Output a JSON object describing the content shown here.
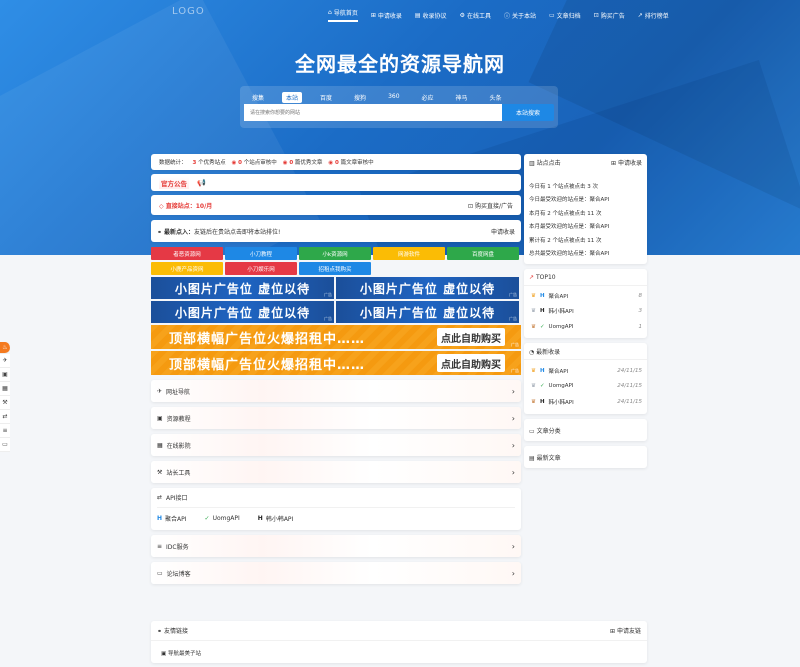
{
  "header": {
    "logo": "LOGO",
    "nav": [
      {
        "label": "导航首页",
        "icon": "home-icon",
        "glyph": "⌂"
      },
      {
        "label": "申请收录",
        "icon": "plus-square-icon",
        "glyph": "⊞"
      },
      {
        "label": "收录协议",
        "icon": "file-icon",
        "glyph": "▤"
      },
      {
        "label": "在线工具",
        "icon": "tools-icon",
        "glyph": "⚙"
      },
      {
        "label": "关于本站",
        "icon": "info-icon",
        "glyph": "ⓘ"
      },
      {
        "label": "文章归档",
        "icon": "folder-icon",
        "glyph": "▭"
      },
      {
        "label": "购买广告",
        "icon": "cart-icon",
        "glyph": "⊡"
      },
      {
        "label": "排行榜单",
        "icon": "chart-icon",
        "glyph": "↗"
      }
    ],
    "title": "全网最全的资源导航网"
  },
  "search": {
    "tabs": [
      "搜集",
      "本站",
      "百度",
      "搜狗",
      "360",
      "必应",
      "神马",
      "头条"
    ],
    "active_tab": 1,
    "placeholder": "请在搜索你想要的网站",
    "button": "本站搜索"
  },
  "stats": {
    "label": "数据统计：",
    "sites_num": "3",
    "sites_text": "个优秀站点",
    "review_num": "0",
    "review_text": "个站点审核中",
    "articles_num": "0",
    "articles_text": "篇优秀文章",
    "articles_review_num": "0",
    "articles_review_text": "篇文章审核中"
  },
  "notice": {
    "label": "官方公告",
    "icon": "megaphone-icon"
  },
  "direct": {
    "label": "直接站点：10/月",
    "buy": "购买直接/广告"
  },
  "latest": {
    "label": "最新点入：",
    "text": "友链后在贵站点击即将本站排位!",
    "apply": "申请收录"
  },
  "color_buttons": [
    {
      "label": "者恶资源网",
      "color": "#e53945"
    },
    {
      "label": "小刀教程",
      "color": "#1e88e5"
    },
    {
      "label": "小k资源网",
      "color": "#2ea84a"
    },
    {
      "label": "网游软件",
      "color": "#fbbc05"
    },
    {
      "label": "百度网盘",
      "color": "#2ea84a"
    },
    {
      "label": "小鹿产品资网",
      "color": "#fbbc05"
    },
    {
      "label": "小刀娱乐网",
      "color": "#e53945"
    },
    {
      "label": "招租点我购买",
      "color": "#1e88e5"
    }
  ],
  "ads_small": [
    "小图片广告位 虚位以待",
    "小图片广告位 虚位以待",
    "小图片广告位 虚位以待",
    "小图片广告位 虚位以待"
  ],
  "ad_tag": "广告",
  "ads_wide": {
    "text": "顶部横幅广告位火爆招租中……",
    "button": "点此自助购买"
  },
  "sections": [
    {
      "label": "网址导航",
      "icon": "send-icon",
      "glyph": "✈"
    },
    {
      "label": "资源教程",
      "icon": "book-icon",
      "glyph": "▣"
    },
    {
      "label": "在线影院",
      "icon": "film-icon",
      "glyph": "▦"
    },
    {
      "label": "站长工具",
      "icon": "hammer-icon",
      "glyph": "⚒"
    }
  ],
  "api": {
    "label": "API接口",
    "items": [
      {
        "label": "聚合API",
        "glyph": "H",
        "color": "#1e88e5"
      },
      {
        "label": "UomgAPI",
        "glyph": "✓",
        "color": "#2ea84a"
      },
      {
        "label": "韩小韩API",
        "glyph": "H",
        "color": "#222"
      }
    ]
  },
  "sections2": [
    {
      "label": "IDC服务",
      "icon": "server-icon",
      "glyph": "≡"
    },
    {
      "label": "论坛博客",
      "icon": "monitor-icon",
      "glyph": "▭"
    }
  ],
  "links": {
    "label": "友情链接",
    "apply": "申请友链",
    "item": "导航最美子站"
  },
  "side": {
    "clicks": {
      "label": "站点点击",
      "apply": "申请收录",
      "lines": [
        "今日有 1 个站点被点击 3 次",
        "今日最受欢迎的站点是：聚合API",
        "本月有 2 个站点被点击 11 次",
        "本月最受欢迎的站点是：聚合API",
        "累计有 2 个站点被点击 11 次",
        "总共最受欢迎的站点是：聚合API"
      ]
    },
    "top10": {
      "label": "TOP10",
      "rows": [
        {
          "name": "聚合API",
          "value": "8",
          "glyph": "H",
          "color": "#1e88e5"
        },
        {
          "name": "韩小韩API",
          "value": "3",
          "glyph": "H",
          "color": "#222"
        },
        {
          "name": "UomgAPI",
          "value": "1",
          "glyph": "✓",
          "color": "#2ea84a"
        }
      ]
    },
    "newest": {
      "label": "最新收录",
      "rows": [
        {
          "name": "聚合API",
          "value": "24/11/15",
          "glyph": "H",
          "color": "#1e88e5"
        },
        {
          "name": "UomgAPI",
          "value": "24/11/15",
          "glyph": "✓",
          "color": "#2ea84a"
        },
        {
          "name": "韩小韩API",
          "value": "24/11/15",
          "glyph": "H",
          "color": "#222"
        }
      ]
    },
    "categories": {
      "label": "文章分类"
    },
    "newest_articles": {
      "label": "最新文章"
    }
  },
  "colors": {
    "accent": "#1e88e5",
    "hero": "#1b6cc6",
    "red": "#e53935",
    "orange": "#f59a10"
  }
}
